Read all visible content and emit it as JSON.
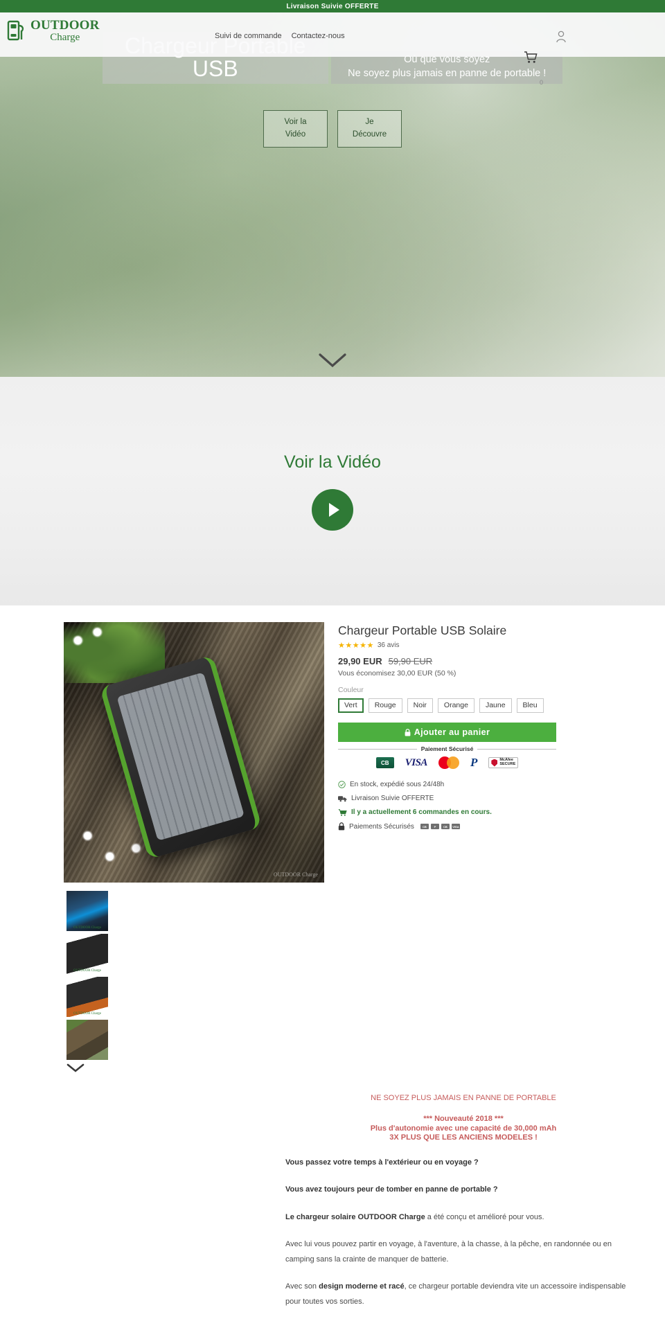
{
  "announcement": {
    "text": "Livraison Suivie OFFERTE"
  },
  "header": {
    "logo": {
      "top": "OUTDOOR",
      "bottom": "Charge",
      "icon": "charger-battery-icon"
    },
    "nav": [
      {
        "label": "Suivi de commande"
      },
      {
        "label": "Contactez-nous"
      }
    ],
    "account_icon": "user-icon",
    "cart_icon": "shopping-cart-icon",
    "cart_count": "0"
  },
  "hero": {
    "title": "Chargeur Portable USB",
    "subtitle_line1": "Où que vous soyez",
    "subtitle_line2": "Ne soyez plus jamais en panne de portable !",
    "buttons": [
      {
        "line1": "Voir la",
        "line2": "Vidéo"
      },
      {
        "line1": "Je",
        "line2": "Découvre"
      }
    ],
    "scroll_icon": "chevron-down-icon"
  },
  "video_section": {
    "title": "Voir la Vidéo",
    "play_icon": "play-icon"
  },
  "product": {
    "title": "Chargeur Portable USB Solaire",
    "stars": "★★★★★",
    "reviews": "36 avis",
    "price_current": "29,90 EUR",
    "price_compare": "59,90 EUR",
    "savings": "Vous économisez 30,00 EUR (50 %)",
    "option_label": "Couleur",
    "colors": [
      {
        "label": "Vert",
        "selected": true
      },
      {
        "label": "Rouge",
        "selected": false
      },
      {
        "label": "Noir",
        "selected": false
      },
      {
        "label": "Orange",
        "selected": false
      },
      {
        "label": "Jaune",
        "selected": false
      },
      {
        "label": "Bleu",
        "selected": false
      }
    ],
    "add_to_cart": "Ajouter au panier",
    "add_to_cart_icon": "lock-icon",
    "payment_label": "Paiement Sécurisé",
    "payment_badges": [
      "CB",
      "VISA",
      "MasterCard",
      "PayPal",
      "McAfee SECURE"
    ],
    "mcafee_line1": "McAfee",
    "mcafee_line2": "SECURE",
    "trust": [
      {
        "icon": "check-circle-icon",
        "text": "En stock, expédié sous 24/48h",
        "style": "normal"
      },
      {
        "icon": "truck-icon",
        "text": "Livraison Suivie OFFERTE",
        "style": "normal"
      },
      {
        "icon": "cart-icon",
        "text": "Il y a actuellement 6 commandes en cours.",
        "style": "green"
      },
      {
        "icon": "lock-icon",
        "text": "Paiements Sécurisés",
        "style": "normal",
        "badges": [
          "CB",
          "P",
          "CB",
          "VISA"
        ]
      }
    ],
    "gallery": {
      "main_alt": "Chargeur solaire vert posé sur un rocher",
      "watermark": "OUTDOOR Charge",
      "thumbnails": [
        {
          "alt": "Chargeur bleu vue ports USB",
          "watermark": "OUTDOOR Charge"
        },
        {
          "alt": "Chargeur noir vue 3/4",
          "watermark": "OUTDOOR Charge"
        },
        {
          "alt": "Chargeur orange vue 3/4",
          "watermark": "OUTDOOR Charge"
        },
        {
          "alt": "Chargeur sur rocher en extérieur",
          "watermark": ""
        }
      ],
      "more_icon": "chevron-down-icon"
    }
  },
  "description": {
    "headline": "NE SOYEZ PLUS JAMAIS EN PANNE DE PORTABLE",
    "promo_line1": "*** Nouveauté 2018 ***",
    "promo_line2": "Plus d'autonomie avec une capacité de 30,000 mAh",
    "promo_line3": "3X PLUS QUE LES ANCIENS MODELES !",
    "paragraphs": [
      {
        "html": "<b>Vous passez votre temps à l'extérieur ou en voyage ?</b>"
      },
      {
        "html": "<b>Vous avez toujours peur de tomber en panne de portable ?</b>"
      },
      {
        "html": "<b>Le chargeur solaire OUTDOOR Charge</b> a été conçu et amélioré pour vous."
      },
      {
        "html": "Avec lui vous pouvez partir en voyage, à l'aventure, à la chasse, à la pêche, en randonnée ou en camping sans la crainte de manquer de batterie."
      },
      {
        "html": "Avec son <b>design moderne et racé</b>, ce chargeur portable deviendra vite un accessoire indispensable pour toutes vos sorties."
      }
    ]
  }
}
